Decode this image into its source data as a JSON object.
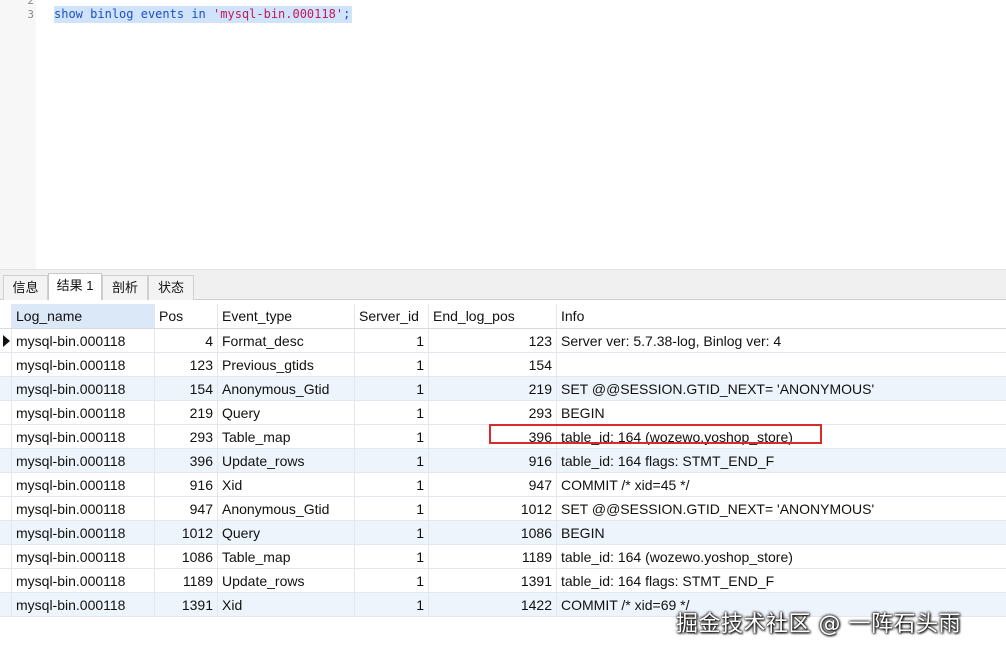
{
  "editor": {
    "line_numbers": [
      "2",
      "3"
    ],
    "query": {
      "kw_show": "show",
      "kw_binlog": "binlog",
      "kw_events": "events",
      "kw_in": "in",
      "file": "'mysql-bin.000118'",
      "terminator": ";"
    }
  },
  "tabs": [
    {
      "label": "信息"
    },
    {
      "label": "结果 1"
    },
    {
      "label": "剖析"
    },
    {
      "label": "状态"
    }
  ],
  "grid": {
    "columns": [
      "Log_name",
      "Pos",
      "Event_type",
      "Server_id",
      "End_log_pos",
      "Info"
    ],
    "rows": [
      [
        "mysql-bin.000118",
        "4",
        "Format_desc",
        "1",
        "123",
        "Server ver: 5.7.38-log, Binlog ver: 4"
      ],
      [
        "mysql-bin.000118",
        "123",
        "Previous_gtids",
        "1",
        "154",
        ""
      ],
      [
        "mysql-bin.000118",
        "154",
        "Anonymous_Gtid",
        "1",
        "219",
        "SET @@SESSION.GTID_NEXT= 'ANONYMOUS'"
      ],
      [
        "mysql-bin.000118",
        "219",
        "Query",
        "1",
        "293",
        "BEGIN"
      ],
      [
        "mysql-bin.000118",
        "293",
        "Table_map",
        "1",
        "396",
        "table_id: 164 (wozewo.yoshop_store)"
      ],
      [
        "mysql-bin.000118",
        "396",
        "Update_rows",
        "1",
        "916",
        "table_id: 164 flags: STMT_END_F"
      ],
      [
        "mysql-bin.000118",
        "916",
        "Xid",
        "1",
        "947",
        "COMMIT /* xid=45 */"
      ],
      [
        "mysql-bin.000118",
        "947",
        "Anonymous_Gtid",
        "1",
        "1012",
        "SET @@SESSION.GTID_NEXT= 'ANONYMOUS'"
      ],
      [
        "mysql-bin.000118",
        "1012",
        "Query",
        "1",
        "1086",
        "BEGIN"
      ],
      [
        "mysql-bin.000118",
        "1086",
        "Table_map",
        "1",
        "1189",
        "table_id: 164 (wozewo.yoshop_store)"
      ],
      [
        "mysql-bin.000118",
        "1189",
        "Update_rows",
        "1",
        "1391",
        "table_id: 164 flags: STMT_END_F"
      ],
      [
        "mysql-bin.000118",
        "1391",
        "Xid",
        "1",
        "1422",
        "COMMIT /* xid=69 */"
      ]
    ]
  },
  "watermark": "掘金技术社区 @ 一阵石头雨",
  "colors": {
    "selection": "#cfe3fb",
    "keyword": "#1f4fc8",
    "string": "#c2185b",
    "row_alt": "#eef4fb",
    "highlight": "#d92b2b"
  }
}
